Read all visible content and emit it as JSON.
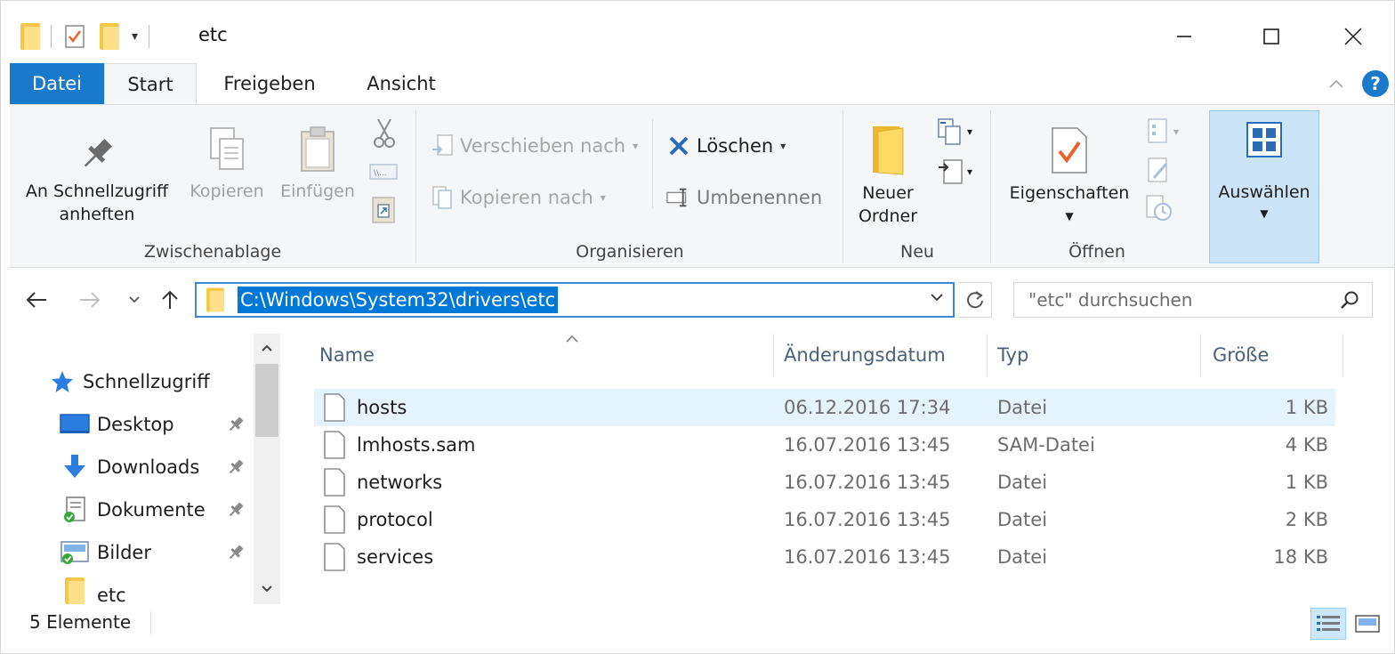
{
  "window": {
    "title": "etc",
    "minimize_glyph": "—",
    "maximize_glyph": "☐",
    "close_glyph": "✕"
  },
  "tabs": {
    "datei": "Datei",
    "start": "Start",
    "freigeben": "Freigeben",
    "ansicht": "Ansicht",
    "help_glyph": "?"
  },
  "ribbon": {
    "clipboard": {
      "label": "Zwischenablage",
      "pin_line1": "An Schnellzugriff",
      "pin_line2": "anheften",
      "copy": "Kopieren",
      "paste": "Einfügen"
    },
    "organize": {
      "label": "Organisieren",
      "move_to": "Verschieben nach",
      "copy_to": "Kopieren nach",
      "delete": "Löschen",
      "rename": "Umbenennen"
    },
    "new": {
      "label": "Neu",
      "new_folder_line1": "Neuer",
      "new_folder_line2": "Ordner"
    },
    "open": {
      "label": "Öffnen",
      "properties": "Eigenschaften"
    },
    "select": {
      "label": "Auswählen"
    }
  },
  "address": {
    "path": "C:\\Windows\\System32\\drivers\\etc",
    "search_placeholder": "\"etc\" durchsuchen"
  },
  "navpane": {
    "quick_access": "Schnellzugriff",
    "items": [
      {
        "label": "Desktop",
        "icon": "desktop-icon"
      },
      {
        "label": "Downloads",
        "icon": "downloads-icon"
      },
      {
        "label": "Dokumente",
        "icon": "documents-icon"
      },
      {
        "label": "Bilder",
        "icon": "pictures-icon"
      },
      {
        "label": "etc",
        "icon": "folder-icon"
      }
    ]
  },
  "filelist": {
    "columns": {
      "name": "Name",
      "date": "Änderungsdatum",
      "type": "Typ",
      "size": "Größe"
    },
    "rows": [
      {
        "name": "hosts",
        "date": "06.12.2016 17:34",
        "type": "Datei",
        "size": "1 KB",
        "selected": true
      },
      {
        "name": "lmhosts.sam",
        "date": "16.07.2016 13:45",
        "type": "SAM-Datei",
        "size": "4 KB"
      },
      {
        "name": "networks",
        "date": "16.07.2016 13:45",
        "type": "Datei",
        "size": "1 KB"
      },
      {
        "name": "protocol",
        "date": "16.07.2016 13:45",
        "type": "Datei",
        "size": "2 KB"
      },
      {
        "name": "services",
        "date": "16.07.2016 13:45",
        "type": "Datei",
        "size": "18 KB"
      }
    ]
  },
  "statusbar": {
    "count": "5 Elemente"
  },
  "colors": {
    "accent": "#1979ca",
    "selection": "#0078d7",
    "row_selected": "#e5f3ff",
    "folder": "#f3c74a"
  }
}
